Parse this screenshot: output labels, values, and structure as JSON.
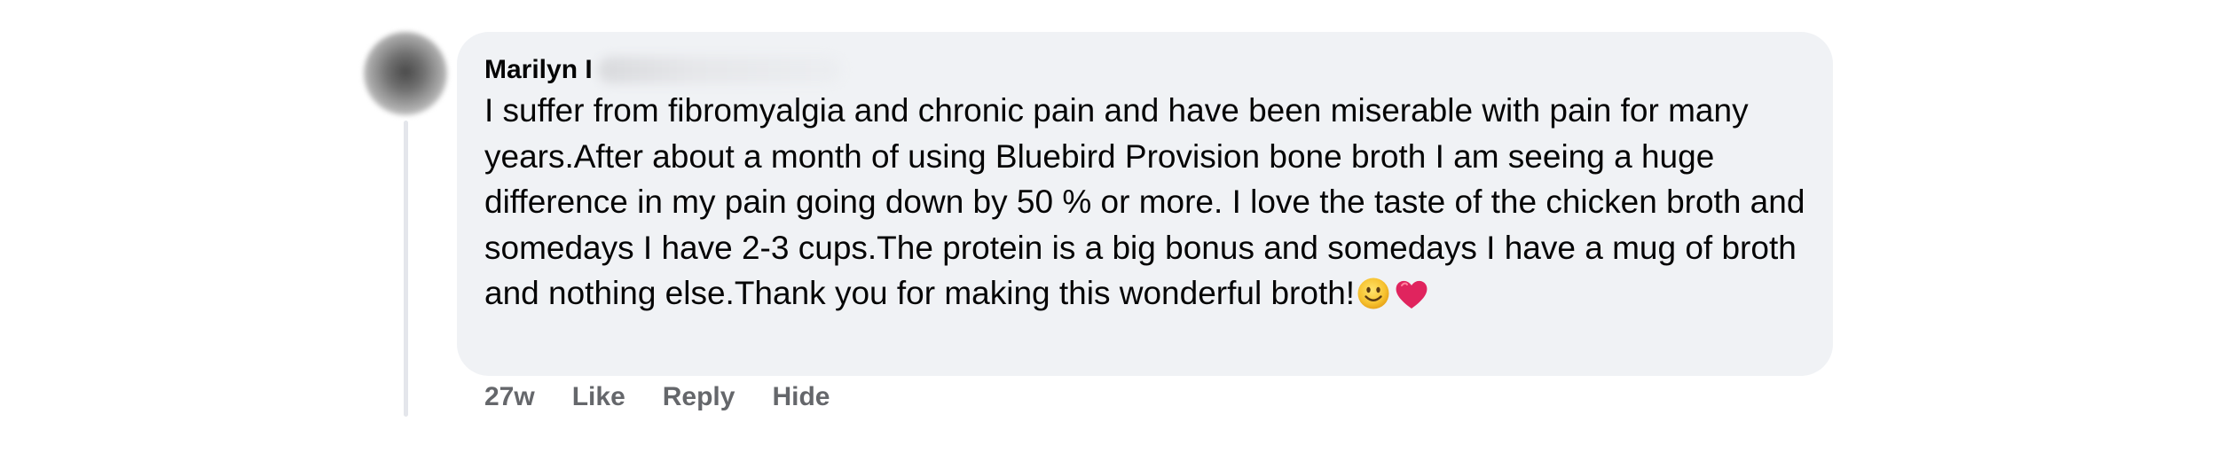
{
  "comment": {
    "author_visible": "Marilyn I",
    "text": "I suffer from fibromyalgia and chronic pain and have been miserable with pain for many years.After about a month of using Bluebird Provision bone broth I am seeing a huge difference in my pain going down by 50 % or more. I love the taste of the chicken broth and somedays I have 2-3 cups.The protein is a big bonus and somedays I have a mug of broth and nothing else.Thank you for making this wonderful broth!",
    "emojis": [
      "smiling-face-emoji",
      "red-heart-emoji"
    ]
  },
  "actions": {
    "timestamp": "27w",
    "like_label": "Like",
    "reply_label": "Reply",
    "hide_label": "Hide"
  },
  "colors": {
    "bubble_background": "#f0f2f5",
    "text": "#050505",
    "secondary_text": "#65676b",
    "thread_line": "#e4e6eb",
    "heart": "#e0245e"
  }
}
